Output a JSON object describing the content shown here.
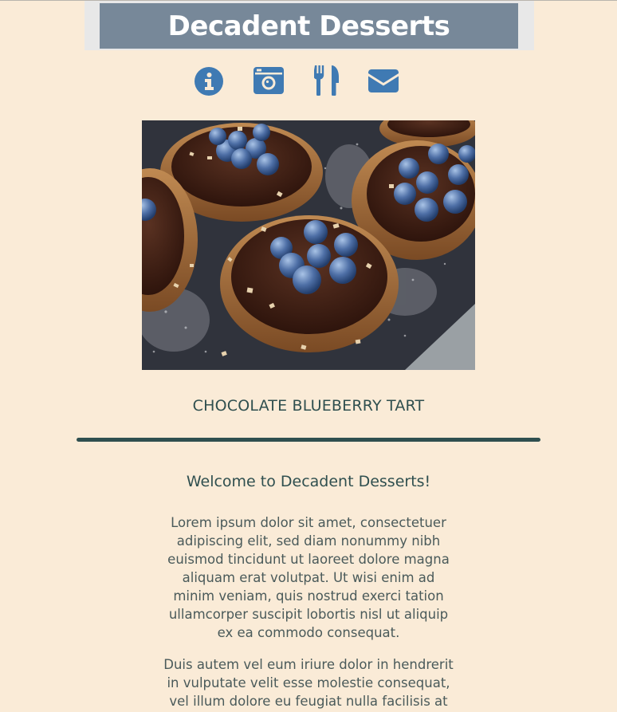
{
  "header": {
    "title": "Decadent Desserts"
  },
  "nav": {
    "items": [
      {
        "icon": "info-icon",
        "name": "nav-about"
      },
      {
        "icon": "camera-icon",
        "name": "nav-gallery"
      },
      {
        "icon": "utensils-icon",
        "name": "nav-menu"
      },
      {
        "icon": "envelope-icon",
        "name": "nav-contact"
      }
    ]
  },
  "colors": {
    "page_background": "#faebd7",
    "header_box": "#778899",
    "header_band": "#e8e8e8",
    "icon_blue": "#3f7ab3",
    "text_dark": "#2f4f4f"
  },
  "hero": {
    "alt": "chocolate blueberry tarts"
  },
  "main": {
    "dish_title": "CHOCOLATE BLUEBERRY TART",
    "welcome": "Welcome to Decadent Desserts!",
    "paragraph1": "Lorem ipsum dolor sit amet, consectetuer adipiscing elit, sed diam nonummy nibh euismod tincidunt ut laoreet dolore magna aliquam erat volutpat. Ut wisi enim ad minim veniam, quis nostrud exerci tation ullamcorper suscipit lobortis nisl ut aliquip ex ea commodo consequat.",
    "paragraph2": "Duis autem vel eum iriure dolor in hendrerit in vulputate velit esse molestie consequat, vel illum dolore eu feugiat nulla facilisis at"
  }
}
